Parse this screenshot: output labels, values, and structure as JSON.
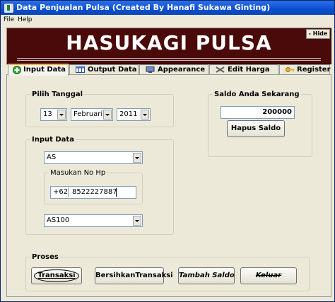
{
  "window": {
    "title": "Data Penjualan Pulsa (Created By Hanafi Sukawa Ginting)"
  },
  "menu": {
    "items": [
      "File",
      "Help"
    ]
  },
  "banner": {
    "title": "HASUKAGI PULSA",
    "hide_label": "- Hide",
    "background_color": "#4a0a0a"
  },
  "tabs": [
    {
      "label": "Input Data",
      "icon": "plus-circle-icon",
      "active": true
    },
    {
      "label": "Output Data",
      "icon": "table-icon",
      "active": false
    },
    {
      "label": "Appearance",
      "icon": "monitor-icon",
      "active": false
    },
    {
      "label": "Edit Harga",
      "icon": "tools-icon",
      "active": false
    },
    {
      "label": "Register",
      "icon": "key-icon",
      "active": false
    }
  ],
  "pilih_tanggal": {
    "legend": "Pilih Tanggal",
    "day": "13",
    "month": "Februari",
    "year": "2011"
  },
  "saldo": {
    "legend": "Saldo Anda Sekarang",
    "value": "200000",
    "hapus_label": "Hapus Saldo"
  },
  "input_data": {
    "legend": "Input Data",
    "operator": "AS",
    "nohp_legend": "Masukan No Hp",
    "prefix": "+62",
    "nohp": "8522227887",
    "nominal": "AS100"
  },
  "proses": {
    "legend": "Proses",
    "transaksi": "Transaksi",
    "bersihkan": "BersihkanTransaksi",
    "tambah_saldo": "Tambah Saldo",
    "keluar": "Keluar"
  }
}
